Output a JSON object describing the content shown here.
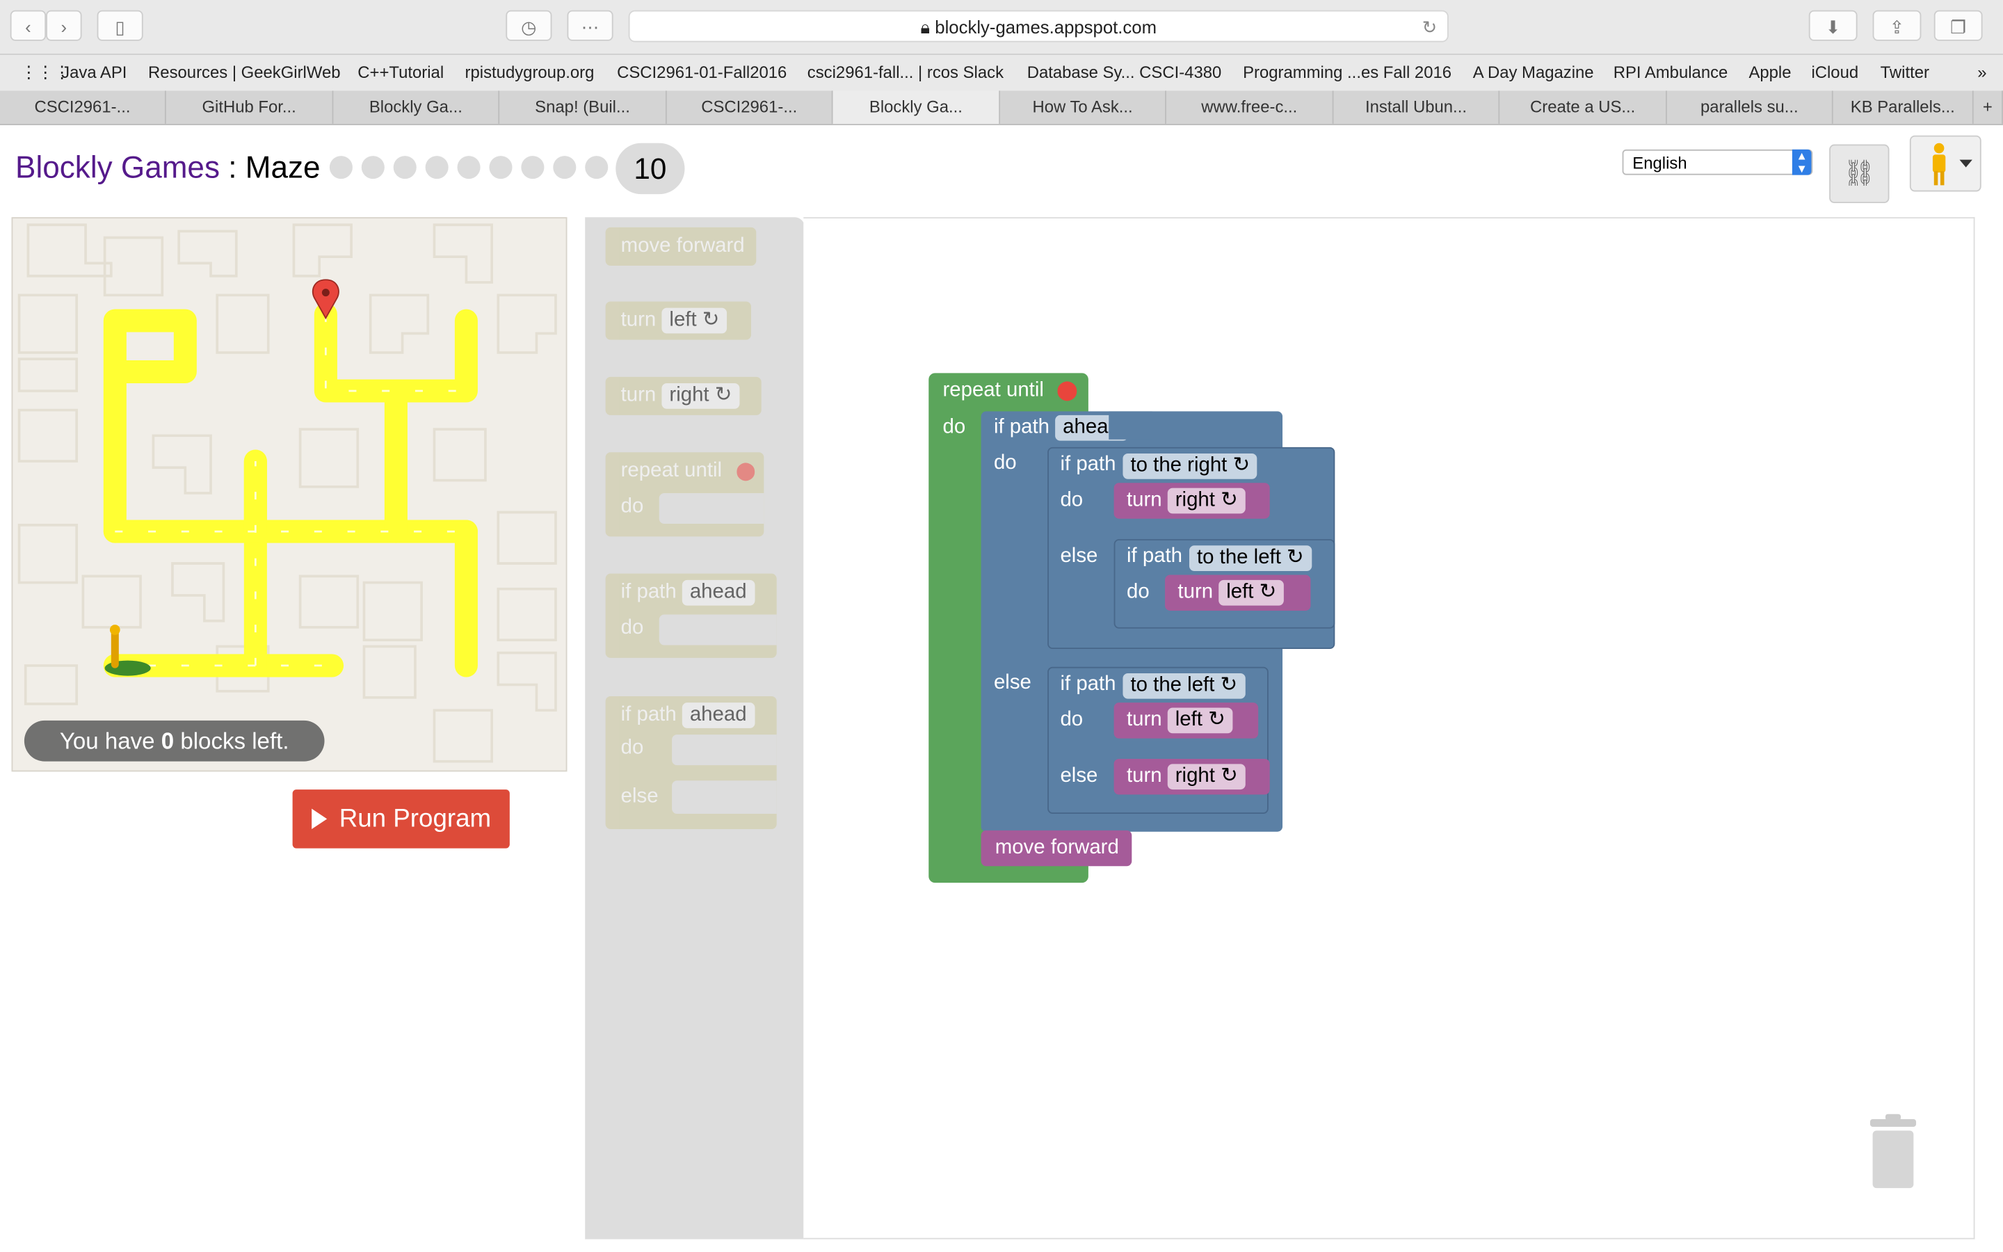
{
  "browser": {
    "url": "blockly-games.appspot.com",
    "bookmarks": [
      "Java API",
      "Resources | GeekGirlWeb",
      "C++Tutorial",
      "rpistudygroup.org",
      "CSCI2961-01-Fall2016",
      "csci2961-fall... | rcos Slack",
      "Database Sy... CSCI-4380",
      "Programming ...es Fall 2016",
      "A Day Magazine",
      "RPI Ambulance",
      "Apple",
      "iCloud",
      "Twitter"
    ],
    "tabs": [
      "CSCI2961-...",
      "GitHub For...",
      "Blockly Ga...",
      "Snap! (Buil...",
      "CSCI2961-...",
      "Blockly Ga...",
      "How To Ask...",
      "www.free-c...",
      "Install Ubun...",
      "Create a US...",
      "parallels su...",
      "KB Parallels..."
    ],
    "active_tab_index": 5
  },
  "app": {
    "brand": "Blockly Games",
    "separator": " : ",
    "game": "Maze",
    "level": "10",
    "language": "English"
  },
  "maze": {
    "blocks_left_prefix": "You have ",
    "blocks_left_count": "0",
    "blocks_left_suffix": " blocks left."
  },
  "run_label": "Run Program",
  "toolbox": {
    "move_forward": "move forward",
    "turn": "turn",
    "left": "left ↻",
    "right": "right ↻",
    "repeat_until": "repeat until",
    "do": "do",
    "if_path": "if path",
    "ahead": "ahead",
    "else": "else"
  },
  "program": {
    "repeat_until": "repeat until",
    "do": "do",
    "else": "else",
    "if_path": "if path",
    "ahead": "ahead",
    "to_the_right": "to the right ↻",
    "to_the_left": "to the left ↻",
    "turn": "turn",
    "right": "right ↻",
    "left": "left ↻",
    "move_forward": "move forward"
  },
  "colors": {
    "logic_blue": "#5b80a5",
    "loop_green": "#5ba55b",
    "action_purple": "#a55b99",
    "run_red": "#dd4b39",
    "path_yellow": "#ffff33"
  }
}
